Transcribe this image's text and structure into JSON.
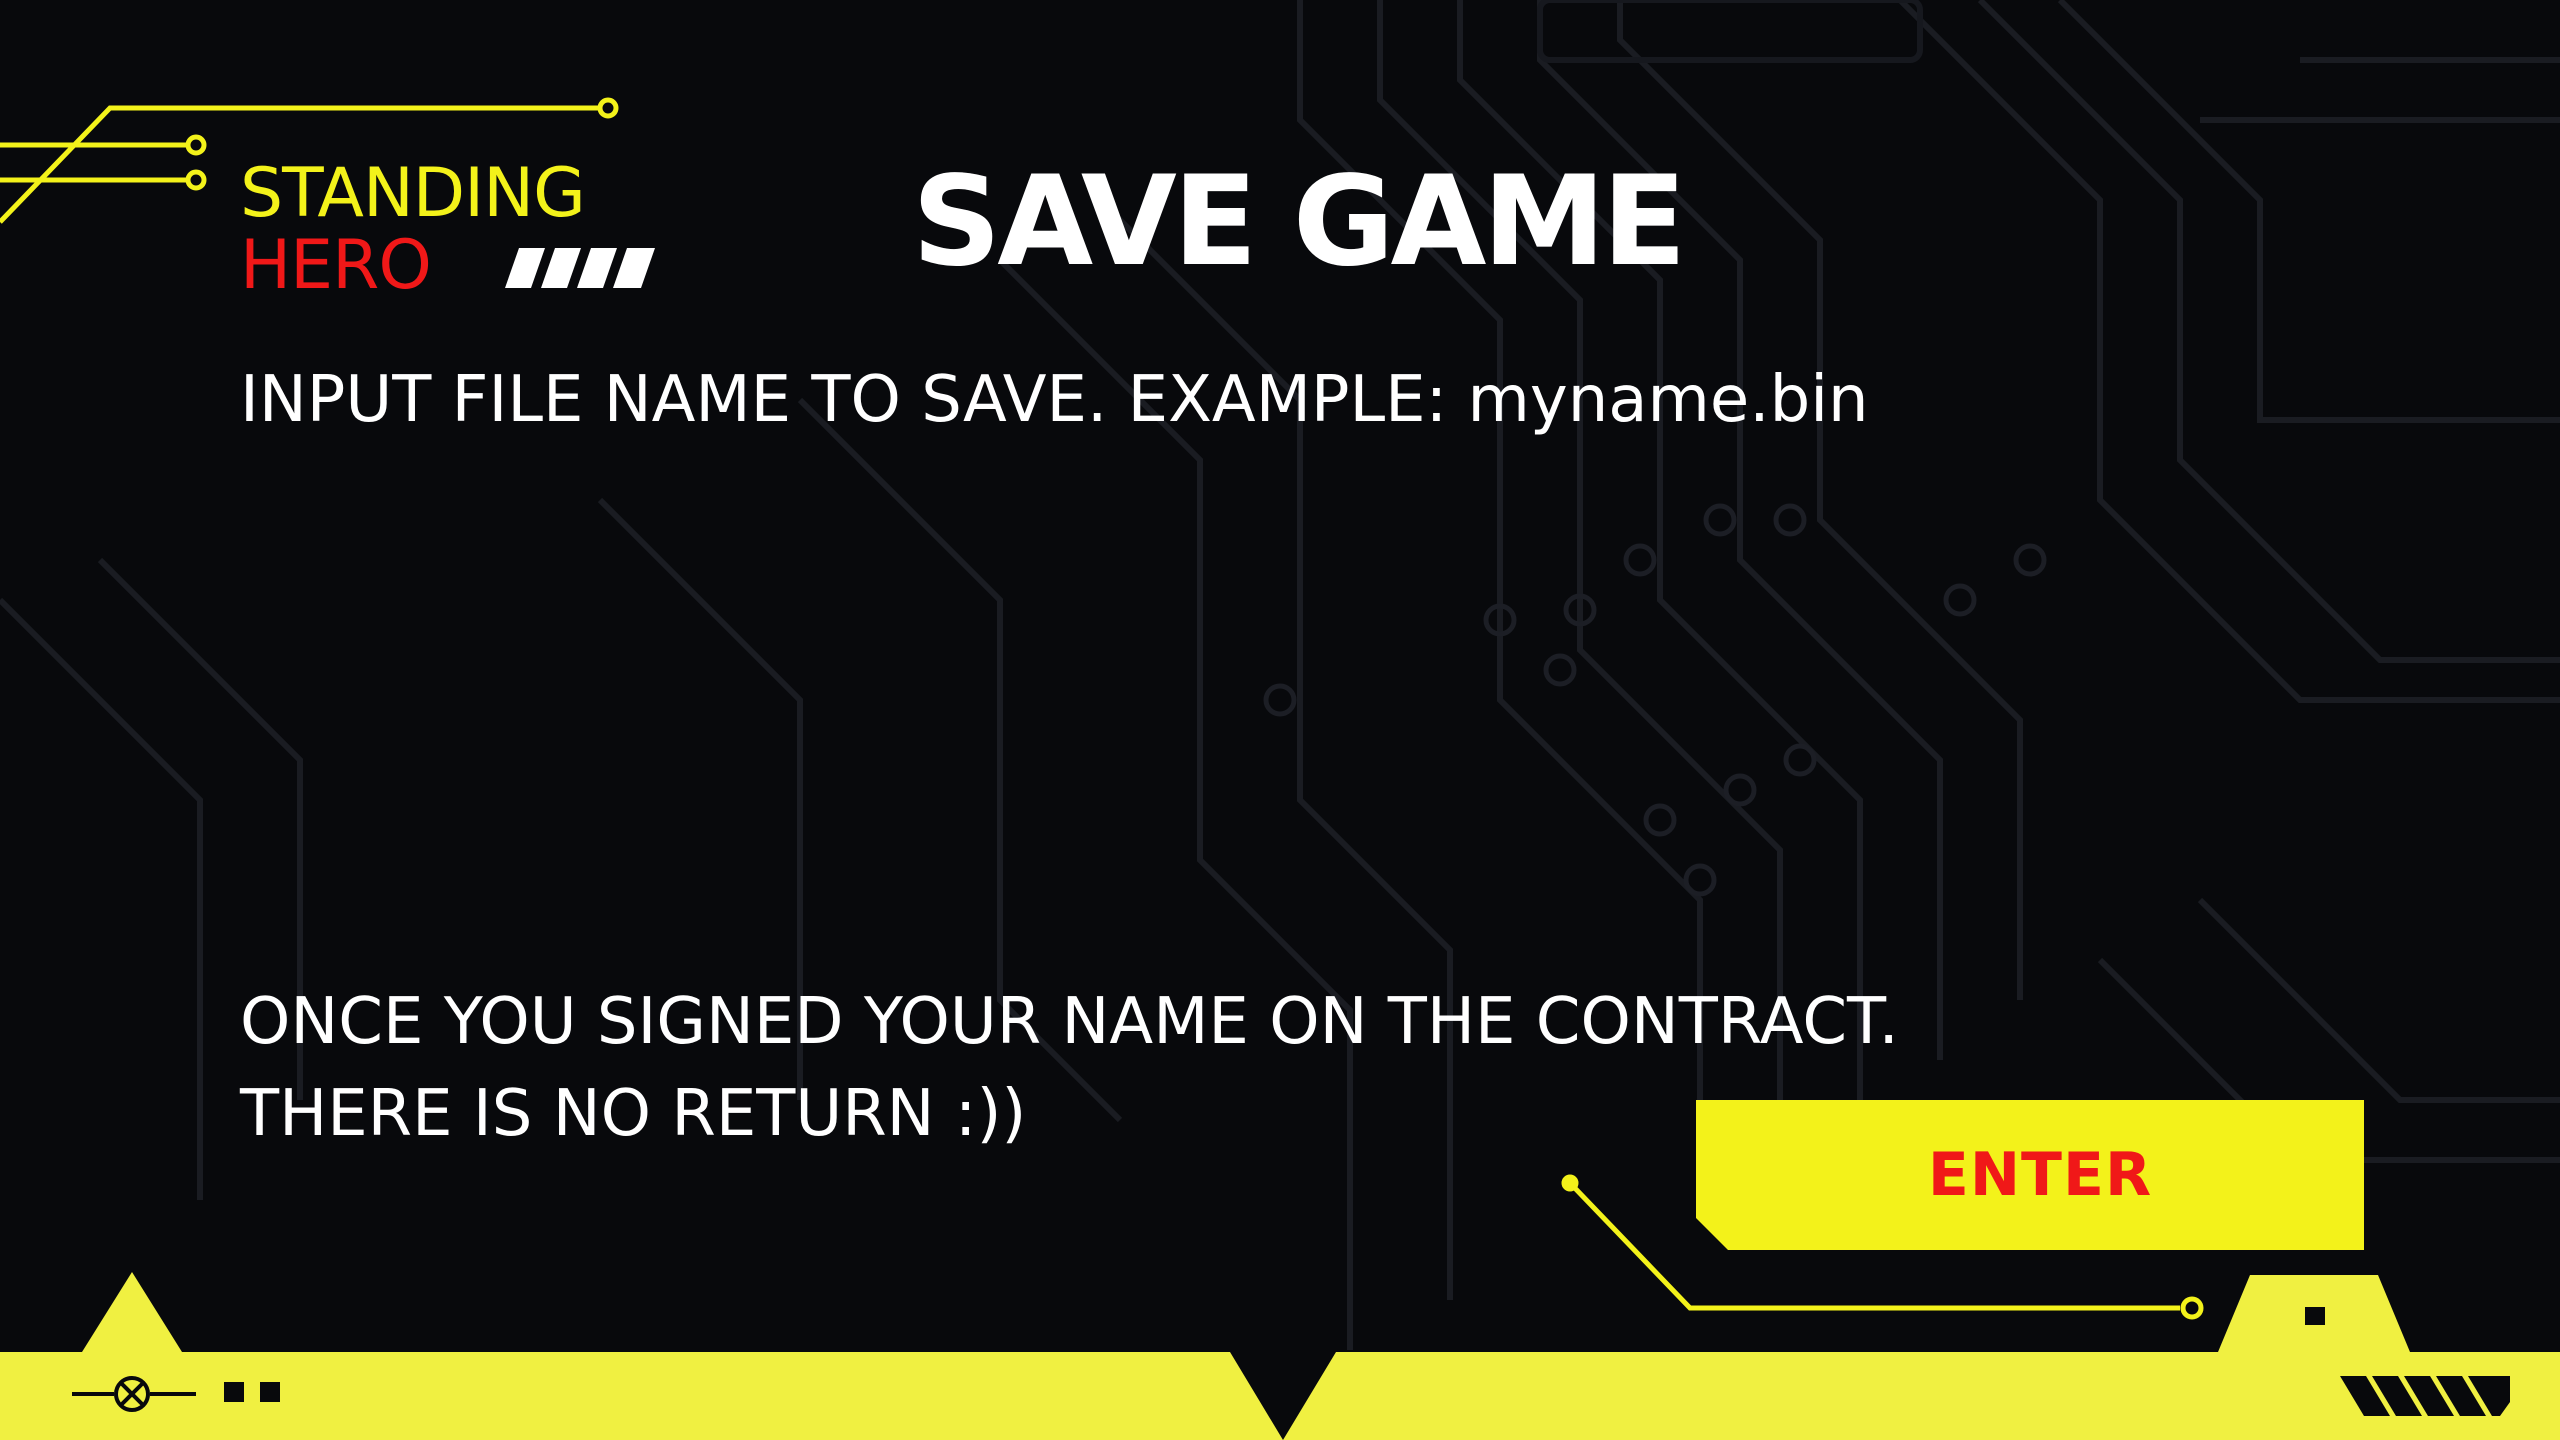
{
  "logo": {
    "line1": "STANDING",
    "line2": "HERO"
  },
  "title": "SAVE GAME",
  "instruction": "INPUT FILE NAME TO SAVE. EXAMPLE: myname.bin",
  "filename_input": {
    "value": "",
    "placeholder": ""
  },
  "warning": {
    "line1": "ONCE YOU SIGNED YOUR NAME ON THE CONTRACT.",
    "line2": "THERE IS NO RETURN :))"
  },
  "enter_button": {
    "label": "ENTER"
  },
  "colors": {
    "background": "#08090c",
    "accent_yellow": "#f3f21a",
    "footer_yellow": "#f0f041",
    "brand_red": "#f01818",
    "text": "#ffffff"
  },
  "icons": {
    "footer_left": "crossed-circle-icon",
    "footer_squares": "double-square-icon",
    "footer_right": "hazard-stripes-icon",
    "logo": "hazard-stripes-icon"
  }
}
